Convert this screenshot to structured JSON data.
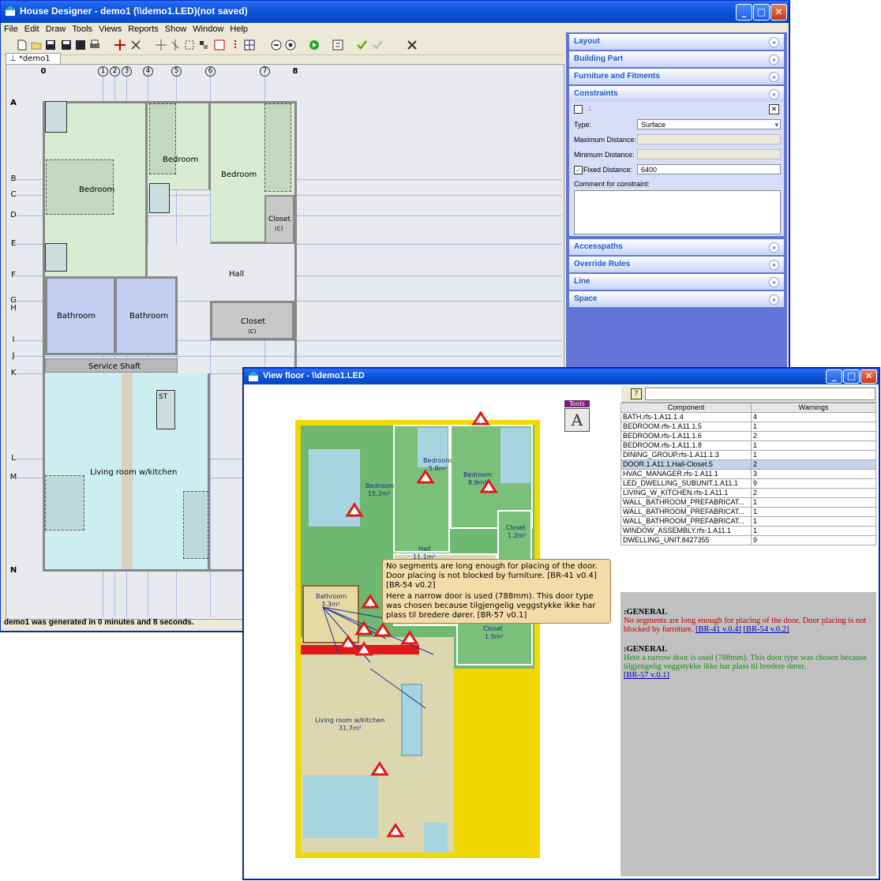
{
  "main_window": {
    "title": "House Designer - demo1 (\\\\demo1.LED)(not saved)",
    "menu": [
      "File",
      "Edit",
      "Draw",
      "Tools",
      "Views",
      "Reports",
      "Show",
      "Window",
      "Help"
    ],
    "tab": "*demo1",
    "status": "demo1 was generated in 0 minutes and 8 seconds.",
    "axes_top": [
      "0",
      "1",
      "2",
      "3",
      "4",
      "5",
      "6",
      "7",
      "8"
    ],
    "axes_left": [
      "A",
      "B",
      "C",
      "D",
      "E",
      "F",
      "G",
      "H",
      "I",
      "J",
      "K",
      "L",
      "M",
      "N"
    ],
    "rooms": {
      "bedroom1": "Bedroom",
      "bedroom2": "Bedroom",
      "bedroom3": "Bedroom",
      "closet1": "Closet",
      "closet1_tag": "(C)",
      "hall": "Hall",
      "bathroom1": "Bathroom",
      "bathroom2": "Bathroom",
      "closet2": "Closet",
      "closet2_tag": "(C)",
      "service_shaft": "Service Shaft",
      "living": "Living room w/kitchen",
      "st": "ST"
    }
  },
  "side_panel": {
    "sections": {
      "layout": "Layout",
      "building_part": "Building Part",
      "furniture": "Furniture and Fitments",
      "constraints": "Constraints",
      "accesspaths": "Accesspaths",
      "override": "Override Rules",
      "line": "Line",
      "space": "Space"
    },
    "type_label": "Type:",
    "type_value": "Surface",
    "max_label": "Maximum Distance:",
    "min_label": "Minimum Distance:",
    "fixed_label": "Fixed Distance:",
    "fixed_value": "6400",
    "comment_label": "Comment for constraint:"
  },
  "view_window": {
    "title": "View floor - \\\\demo1.LED",
    "tools_label": "Tools",
    "table_headers": [
      "Component",
      "Warnings"
    ],
    "rows": [
      {
        "c": "BATH.rfs-1.A11.1.4",
        "w": "4"
      },
      {
        "c": "BEDROOM.rfs-1.A11.1.5",
        "w": "1"
      },
      {
        "c": "BEDROOM.rfs-1.A11.1.6",
        "w": "2"
      },
      {
        "c": "BEDROOM.rfs-1.A11.1.8",
        "w": "1"
      },
      {
        "c": "DINING_GROUP.rfs-1.A11.1.3",
        "w": "1"
      },
      {
        "c": "DOOR.1.A11.1.Hall-Closet.5",
        "w": "2"
      },
      {
        "c": "HVAC_MANAGER.rfs-1.A11.1",
        "w": "3"
      },
      {
        "c": "LED_DWELLING_SUBUNIT.1.A11.1",
        "w": "9"
      },
      {
        "c": "LIVING_W_KITCHEN.rfs-1.A11.1",
        "w": "2"
      },
      {
        "c": "WALL_BATHROOM_PREFABRICAT...",
        "w": "1"
      },
      {
        "c": "WALL_BATHROOM_PREFABRICAT...",
        "w": "1"
      },
      {
        "c": "WALL_BATHROOM_PREFABRICAT...",
        "w": "1"
      },
      {
        "c": "WINDOW_ASSEMBLY.rfs-1.A11.1",
        "w": "1"
      },
      {
        "c": "DWELLING_UNIT.8427355",
        "w": "9"
      }
    ],
    "tooltip_1": "No segments are long enough for placing of the door. Door placing is not blocked by furniture. [BR-41 v0.4][BR-54 v0.2]",
    "tooltip_2": "Here a narrow door is used (788mm). This door type was chosen because tilgjengelig veggstykke ikke har plass til bredere dører. [BR-57 v0.1]",
    "info": {
      "h1": ":GENERAL",
      "t1": "No segments are long enough for placing of the door. Door placing is not blocked by furniture.",
      "l1a": "[BR-41 v.0.4]",
      "l1b": "[BR-54 v.0.2]",
      "h2": ":GENERAL",
      "t2": "Here a narrow door is used (788mm). This door type was chosen because tilgjengelig veggstykke ikke har plass til bredere dører.",
      "l2": "[BR-57 v.0.1]"
    },
    "rooms": {
      "bedroom_a": "Bedroom",
      "bedroom_a_area": "15.2m²",
      "bedroom_b": "Bedroom",
      "bedroom_b_area": "5.8m²",
      "bedroom_c": "Bedroom",
      "bedroom_c_area": "8.9m²",
      "closet_a": "Closet",
      "closet_a_area": "1.2m²",
      "hall": "Hall",
      "hall_area": "11.1m²",
      "bathroom": "Bathroom",
      "bathroom_area": "3.3m²",
      "closet_b": "Closet",
      "closet_b_area": "1.5m²",
      "living": "Living room w/kitchen",
      "living_area": "31.7m²"
    }
  }
}
